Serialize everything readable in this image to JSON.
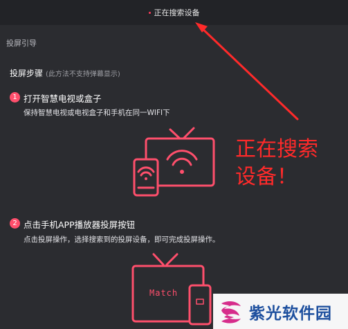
{
  "header": {
    "title": "正在搜索设备"
  },
  "guide_link": "投屏引导",
  "steps_section": {
    "title": "投屏步骤",
    "note": "(此方法不支持弹幕显示)"
  },
  "steps": [
    {
      "number": "1",
      "title": "打开智慧电视或盒子",
      "desc": "保持智慧电视或电视盒子和手机在同一WIFI下"
    },
    {
      "number": "2",
      "title": "点击手机APP播放器投屏按钮",
      "desc": "点击投屏操作，选择搜索到的投屏设备，即可完成投屏操作。"
    }
  ],
  "illustration2": {
    "tv_text": "Match"
  },
  "annotation": {
    "line1": "正在搜索",
    "line2": "设备！"
  },
  "watermark": {
    "text": "紫光软件园"
  },
  "colors": {
    "accent": "#ff4f6c",
    "annotation": "#ff2a2a",
    "background": "#2b2c30",
    "header_bg": "#222327"
  }
}
